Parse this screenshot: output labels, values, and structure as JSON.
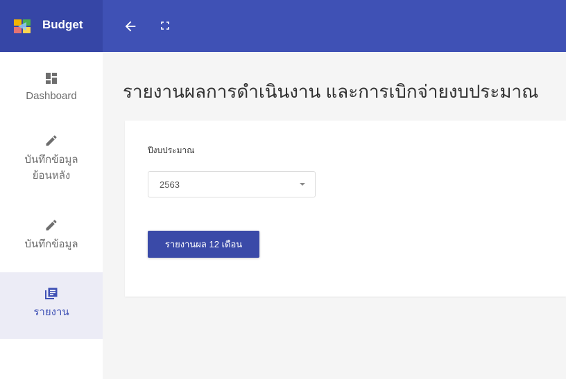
{
  "app": {
    "brand_title": "Budget"
  },
  "colors": {
    "topbar": "#3f51b5",
    "brand_area": "#3646a6",
    "accent": "#3f51b5",
    "active_nav_bg": "#ececf6"
  },
  "topbar": {
    "icons": [
      "back-arrow-icon",
      "fullscreen-icon"
    ]
  },
  "sidebar": {
    "items": [
      {
        "label_lines": [
          "Dashboard"
        ],
        "icon": "dashboard-grid-icon",
        "active": false
      },
      {
        "label_lines": [
          "บันทึกข้อมูล",
          "ย้อนหลัง"
        ],
        "icon": "pencil-icon",
        "active": false
      },
      {
        "label_lines": [
          "บันทึกข้อมูล"
        ],
        "icon": "pencil-icon",
        "active": false
      },
      {
        "label_lines": [
          "รายงาน"
        ],
        "icon": "report-icon",
        "active": true
      }
    ]
  },
  "main": {
    "title": "รายงานผลการดำเนินงาน และการเบิกจ่ายงบประมาณ",
    "form": {
      "fiscal_year_label": "ปีงบประมาณ",
      "fiscal_year_value": "2563",
      "report_button_label": "รายงานผล 12 เดือน"
    }
  }
}
